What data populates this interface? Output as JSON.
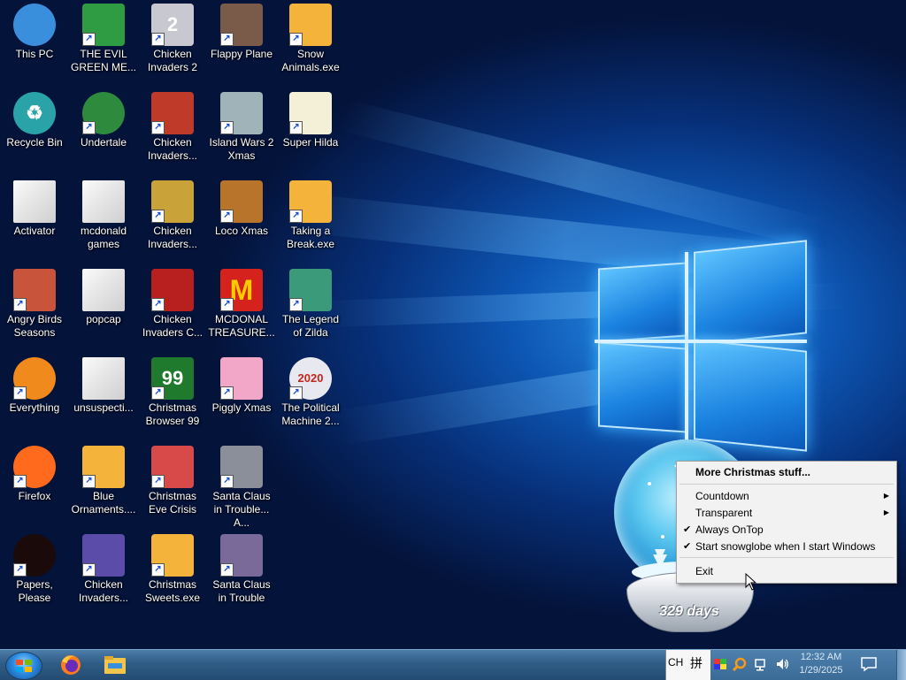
{
  "desktop": {
    "icons": [
      {
        "label": "This PC",
        "icon": "computer-icon",
        "glyph": "",
        "color": "#3a8fdc",
        "shortcut": false
      },
      {
        "label": "Recycle Bin",
        "icon": "recycle-bin-icon",
        "glyph": "♻",
        "color": "#2aa3a8",
        "shortcut": false
      },
      {
        "label": "Activator",
        "icon": "folder-icon",
        "glyph": "",
        "color": "#e8e8e8",
        "shortcut": false
      },
      {
        "label": "Angry Birds Seasons",
        "icon": "angry-birds-icon",
        "glyph": "",
        "color": "#c8543b",
        "shortcut": true
      },
      {
        "label": "Everything",
        "icon": "magnifier-icon",
        "glyph": "",
        "color": "#f08a1c",
        "shortcut": true
      },
      {
        "label": "Firefox",
        "icon": "firefox-icon",
        "glyph": "",
        "color": "#ff6a1c",
        "shortcut": true
      },
      {
        "label": "Papers, Please",
        "icon": "papers-please-icon",
        "glyph": "",
        "color": "#1a0a0a",
        "shortcut": true
      },
      {
        "label": "THE EVIL GREEN ME...",
        "icon": "messenger-icon",
        "glyph": "",
        "color": "#2f9b43",
        "shortcut": true
      },
      {
        "label": "Undertale",
        "icon": "undertale-icon",
        "glyph": "",
        "color": "#2e8b3e",
        "shortcut": true
      },
      {
        "label": "mcdonald games",
        "icon": "folder-icon",
        "glyph": "",
        "color": "#e8e8e8",
        "shortcut": false
      },
      {
        "label": "popcap",
        "icon": "folder-icon",
        "glyph": "",
        "color": "#e8e8e8",
        "shortcut": false
      },
      {
        "label": "unsuspecti...",
        "icon": "folder-icon",
        "glyph": "",
        "color": "#e8e8e8",
        "shortcut": false
      },
      {
        "label": "Blue Ornaments....",
        "icon": "exe-icon",
        "glyph": "",
        "color": "#f4b43c",
        "shortcut": true
      },
      {
        "label": "Chicken Invaders...",
        "icon": "chicken-invaders-icon",
        "glyph": "",
        "color": "#5a4ca8",
        "shortcut": true
      },
      {
        "label": "Chicken Invaders 2",
        "icon": "chicken-invaders-icon",
        "glyph": "2",
        "color": "#c8c8d0",
        "shortcut": true
      },
      {
        "label": "Chicken Invaders...",
        "icon": "chicken-invaders-icon",
        "glyph": "",
        "color": "#c03a2a",
        "shortcut": true
      },
      {
        "label": "Chicken Invaders...",
        "icon": "chicken-invaders-icon",
        "glyph": "",
        "color": "#c9a23a",
        "shortcut": true
      },
      {
        "label": "Chicken Invaders C...",
        "icon": "chicken-invaders-icon",
        "glyph": "",
        "color": "#b82020",
        "shortcut": true
      },
      {
        "label": "Christmas Browser 99",
        "icon": "christmas-tree-icon",
        "glyph": "99",
        "color": "#1f7a2e",
        "shortcut": true
      },
      {
        "label": "Christmas Eve Crisis",
        "icon": "santa-icon",
        "glyph": "",
        "color": "#d84a4a",
        "shortcut": true
      },
      {
        "label": "Christmas Sweets.exe",
        "icon": "exe-icon",
        "glyph": "",
        "color": "#f4b43c",
        "shortcut": true
      },
      {
        "label": "Flappy Plane",
        "icon": "flappy-plane-icon",
        "glyph": "",
        "color": "#7a5a48",
        "shortcut": true
      },
      {
        "label": "Island Wars 2 Xmas",
        "icon": "island-wars-icon",
        "glyph": "",
        "color": "#9fb3b8",
        "shortcut": true
      },
      {
        "label": "Loco Xmas",
        "icon": "loco-xmas-icon",
        "glyph": "",
        "color": "#b8742a",
        "shortcut": true
      },
      {
        "label": "MCDONAL TREASURE...",
        "icon": "mcdonalds-icon",
        "glyph": "M",
        "color": "#d6221c",
        "shortcut": true
      },
      {
        "label": "Piggly Xmas",
        "icon": "piggly-icon",
        "glyph": "",
        "color": "#f2a6c8",
        "shortcut": true
      },
      {
        "label": "Santa Claus in Trouble... A...",
        "icon": "santa-icon",
        "glyph": "",
        "color": "#8a8f9a",
        "shortcut": true
      },
      {
        "label": "Santa Claus in Trouble",
        "icon": "santa-icon",
        "glyph": "",
        "color": "#7a6a9a",
        "shortcut": true
      },
      {
        "label": "Snow Animals.exe",
        "icon": "exe-icon",
        "glyph": "",
        "color": "#f4b43c",
        "shortcut": true
      },
      {
        "label": "Super Hilda",
        "icon": "super-hilda-icon",
        "glyph": "",
        "color": "#f4f0d8",
        "shortcut": true
      },
      {
        "label": "Taking a Break.exe",
        "icon": "exe-icon",
        "glyph": "",
        "color": "#f4b43c",
        "shortcut": true
      },
      {
        "label": "The Legend of Zilda",
        "icon": "zilda-icon",
        "glyph": "",
        "color": "#3a9a7a",
        "shortcut": true
      },
      {
        "label": "The Political Machine 2...",
        "icon": "political-machine-icon",
        "glyph": "2020",
        "color": "#e8e8f0",
        "shortcut": true
      }
    ]
  },
  "snowglobe": {
    "days_label": "329 days"
  },
  "context_menu": {
    "items": [
      {
        "label": "More Christmas stuff...",
        "bold": true,
        "checked": false,
        "submenu": false
      },
      {
        "label": "Countdown",
        "bold": false,
        "checked": false,
        "submenu": true
      },
      {
        "label": "Transparent",
        "bold": false,
        "checked": false,
        "submenu": true
      },
      {
        "label": "Always OnTop",
        "bold": false,
        "checked": true,
        "submenu": false
      },
      {
        "label": "Start snowglobe when I start Windows",
        "bold": false,
        "checked": true,
        "submenu": false
      },
      {
        "label": "Exit",
        "bold": false,
        "checked": false,
        "submenu": false
      }
    ]
  },
  "taskbar": {
    "pinned": [
      {
        "name": "firefox",
        "icon": "firefox-icon"
      },
      {
        "name": "file-explorer",
        "icon": "folder-icon"
      }
    ],
    "tray": {
      "language": "CH",
      "ime_glyph": "拼",
      "time": "12:32 AM",
      "date": "1/29/2025"
    }
  }
}
